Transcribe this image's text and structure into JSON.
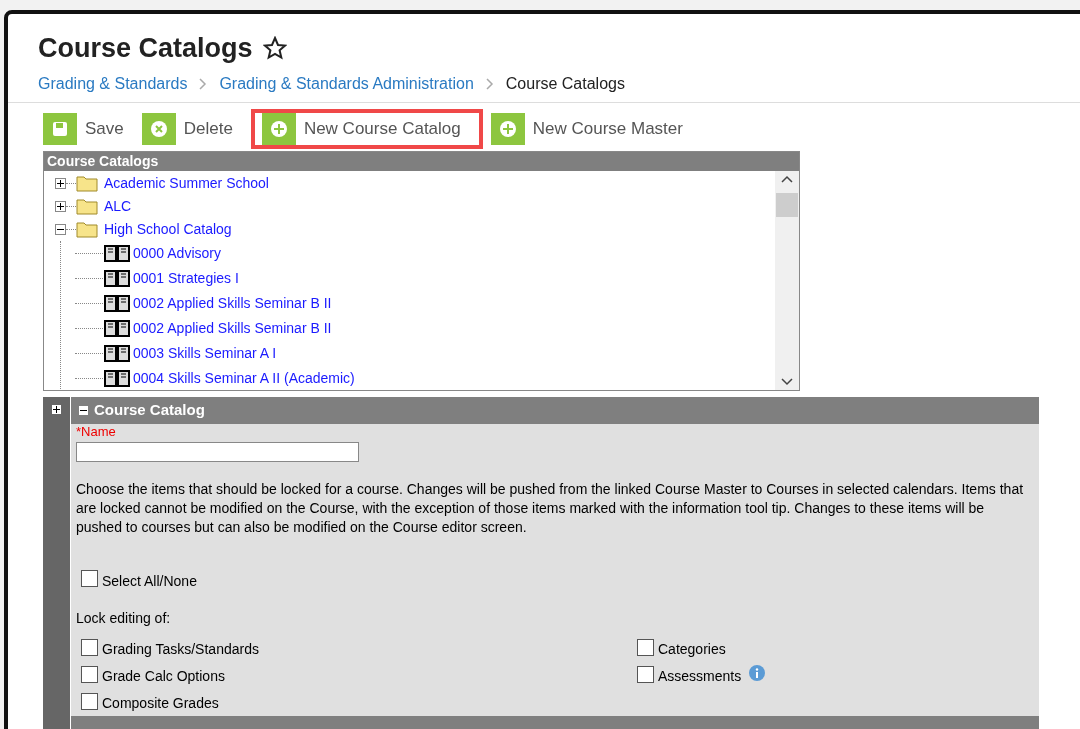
{
  "page": {
    "title": "Course Catalogs",
    "breadcrumb": [
      {
        "label": "Grading & Standards",
        "kind": "link"
      },
      {
        "label": "Grading & Standards Administration",
        "kind": "link"
      },
      {
        "label": "Course Catalogs",
        "kind": "current"
      }
    ]
  },
  "toolbar": [
    {
      "label": "Save",
      "highlighted": false
    },
    {
      "label": "Delete",
      "highlighted": false
    },
    {
      "label": "New Course Catalog",
      "highlighted": true
    },
    {
      "label": "New Course Master",
      "highlighted": false
    }
  ],
  "tree": {
    "title": "Course Catalogs",
    "items": [
      {
        "label": "Academic Summer School",
        "kind": "folder",
        "expanded": false
      },
      {
        "label": "ALC",
        "kind": "folder",
        "expanded": false
      },
      {
        "label": "High School Catalog",
        "kind": "folder",
        "expanded": true,
        "children": [
          {
            "label": "0000 Advisory",
            "kind": "course"
          },
          {
            "label": "0001 Strategies I",
            "kind": "course"
          },
          {
            "label": "0002 Applied Skills Seminar B II",
            "kind": "course"
          },
          {
            "label": "0002 Applied Skills Seminar B II",
            "kind": "course"
          },
          {
            "label": "0003 Skills Seminar A I",
            "kind": "course"
          },
          {
            "label": "0004 Skills Seminar A II (Academic)",
            "kind": "course"
          }
        ]
      }
    ]
  },
  "detail": {
    "title": "Course Catalog",
    "name_label": "*Name",
    "description": "Choose the items that should be locked for a course. Changes will be pushed from the linked Course Master to Courses in selected calendars. Items that are locked cannot be modified on the Course, with the exception of those items marked with the information tool tip. Changes to these items will be pushed to courses but can also be modified on the Course editor screen.",
    "select_all": {
      "label": "Select All/None",
      "checked": false
    },
    "lock_label": "Lock editing of:",
    "locks": [
      {
        "label": "Grading Tasks/Standards",
        "checked": false,
        "info": false
      },
      {
        "label": "Categories",
        "checked": false,
        "info": false
      },
      {
        "label": "Grade Calc Options",
        "checked": false,
        "info": false
      },
      {
        "label": "Assessments",
        "checked": false,
        "info": true
      },
      {
        "label": "Composite Grades",
        "checked": false,
        "info": false
      }
    ]
  }
}
